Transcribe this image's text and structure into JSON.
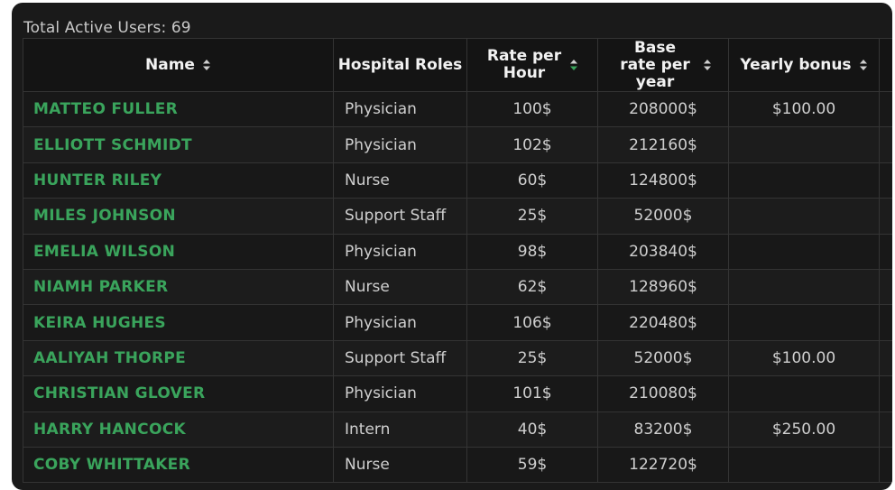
{
  "summary": {
    "label": "Total Active Users: 69"
  },
  "columns": [
    {
      "label": "Name",
      "sort": "none"
    },
    {
      "label": "Hospital Roles",
      "sort": null
    },
    {
      "label": "Rate per Hour",
      "sort": "active"
    },
    {
      "label": "Base rate per year",
      "sort": "none"
    },
    {
      "label": "Yearly bonus",
      "sort": "none"
    }
  ],
  "colors": {
    "background": "#1a1a1a",
    "name_text": "#3aa45c",
    "cell_text": "#cfcfcf",
    "header_text": "#f2f2f2",
    "sort_active": "#3aa45c",
    "sort_inactive": "#cfcfcf"
  },
  "rows": [
    {
      "name": "MATTEO FULLER",
      "role": "Physician",
      "rate": "100$",
      "base": "208000$",
      "bonus": "$100.00"
    },
    {
      "name": "ELLIOTT SCHMIDT",
      "role": "Physician",
      "rate": "102$",
      "base": "212160$",
      "bonus": ""
    },
    {
      "name": "HUNTER RILEY",
      "role": "Nurse",
      "rate": "60$",
      "base": "124800$",
      "bonus": ""
    },
    {
      "name": "MILES JOHNSON",
      "role": "Support Staff",
      "rate": "25$",
      "base": "52000$",
      "bonus": ""
    },
    {
      "name": "EMELIA WILSON",
      "role": "Physician",
      "rate": "98$",
      "base": "203840$",
      "bonus": ""
    },
    {
      "name": "NIAMH PARKER",
      "role": "Nurse",
      "rate": "62$",
      "base": "128960$",
      "bonus": ""
    },
    {
      "name": "KEIRA HUGHES",
      "role": "Physician",
      "rate": "106$",
      "base": "220480$",
      "bonus": ""
    },
    {
      "name": "AALIYAH THORPE",
      "role": "Support Staff",
      "rate": "25$",
      "base": "52000$",
      "bonus": "$100.00"
    },
    {
      "name": "CHRISTIAN GLOVER",
      "role": "Physician",
      "rate": "101$",
      "base": "210080$",
      "bonus": ""
    },
    {
      "name": "HARRY HANCOCK",
      "role": "Intern",
      "rate": "40$",
      "base": "83200$",
      "bonus": "$250.00"
    },
    {
      "name": "COBY WHITTAKER",
      "role": "Nurse",
      "rate": "59$",
      "base": "122720$",
      "bonus": ""
    }
  ]
}
